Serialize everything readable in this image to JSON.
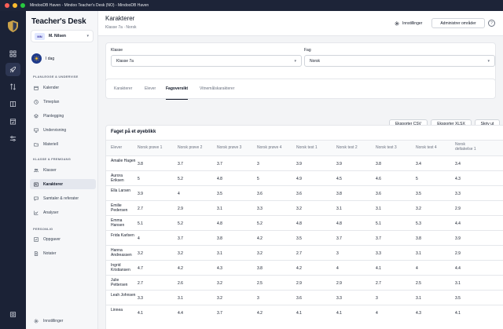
{
  "window": {
    "title": "MindooDB Haven - Mindoo Teacher's Desk (NO) - MindooDB Haven"
  },
  "colors": {
    "accent": "#1e3a8a",
    "rail_bg": "#1b2236",
    "active_nav": "#e4e7ee"
  },
  "rail": {
    "logo_icon": "shield-logo-icon",
    "items": [
      {
        "icon": "grid-icon"
      },
      {
        "icon": "rocket-icon"
      },
      {
        "icon": "arrows-icon"
      },
      {
        "icon": "book-icon"
      },
      {
        "icon": "calendar-check-icon"
      },
      {
        "icon": "sliders-icon"
      }
    ],
    "bottom_icon": "device-icon"
  },
  "sidebar": {
    "brand": "Teacher's Desk",
    "user": {
      "initials": "MN",
      "name": "M. Nilsen"
    },
    "today_label": "I dag",
    "sections": [
      {
        "title": "PLANLEGGE & UNDERVISE",
        "items": [
          {
            "label": "Kalender",
            "icon": "calendar-icon"
          },
          {
            "label": "Timeplan",
            "icon": "clock-icon"
          },
          {
            "label": "Planlegging",
            "icon": "layers-icon"
          },
          {
            "label": "Undervisning",
            "icon": "presentation-icon"
          },
          {
            "label": "Materiell",
            "icon": "folder-icon"
          }
        ]
      },
      {
        "title": "KLASSE & FREMGANG",
        "items": [
          {
            "label": "Klasser",
            "icon": "users-icon"
          },
          {
            "label": "Karakterer",
            "icon": "grade-icon"
          },
          {
            "label": "Samtaler & referater",
            "icon": "chat-icon"
          },
          {
            "label": "Analyser",
            "icon": "chart-icon"
          }
        ]
      },
      {
        "title": "PERSONLIG",
        "items": [
          {
            "label": "Oppgaver",
            "icon": "checkbox-icon"
          },
          {
            "label": "Notater",
            "icon": "note-icon"
          }
        ]
      }
    ],
    "settings_label": "Innstillinger"
  },
  "header": {
    "title": "Karakterer",
    "breadcrumb": "Klasse 7a · Norsk",
    "settings_label": "Innstillinger",
    "admin_label": "Administrer områder",
    "help_label": "?"
  },
  "filters": {
    "class_label": "Klasse",
    "class_value": "Klasse 7a",
    "subject_label": "Fag",
    "subject_value": "Norsk"
  },
  "tabs": [
    "Karakterer",
    "Elever",
    "Fagoversikt",
    "Vitnemålskarakterer"
  ],
  "active_tab_index": 2,
  "card": {
    "title": "Faget på et øyeblikk",
    "export_csv": "Eksporter CSV",
    "export_xlsx": "Eksporter XLSX",
    "print": "Skriv ut"
  },
  "table": {
    "headers": [
      "Elever",
      "Norsk prøve 1",
      "Norsk prøve 2",
      "Norsk prøve 3",
      "Norsk prøve 4",
      "Norsk test 1",
      "Norsk test 2",
      "Norsk test 3",
      "Norsk test 4",
      "Norsk deltakelse 1"
    ],
    "rows": [
      {
        "name": "Amalie Hagen",
        "values": [
          "3.8",
          "3.7",
          "3.7",
          "3",
          "3.9",
          "3.9",
          "3.8",
          "3.4",
          "3.4"
        ]
      },
      {
        "name": "Aurora Eriksen",
        "values": [
          "5",
          "5.2",
          "4.8",
          "5",
          "4.9",
          "4.5",
          "4.6",
          "5",
          "4.3"
        ]
      },
      {
        "name": "Ella Larsen",
        "values": [
          "3.9",
          "4",
          "3.5",
          "3.6",
          "3.6",
          "3.8",
          "3.6",
          "3.5",
          "3.3"
        ]
      },
      {
        "name": "Emilie Pedersen",
        "values": [
          "2.7",
          "2.9",
          "3.1",
          "3.3",
          "3.2",
          "3.1",
          "3.1",
          "3.2",
          "2.9"
        ]
      },
      {
        "name": "Emma Hansen",
        "values": [
          "5.1",
          "5.2",
          "4.8",
          "5.2",
          "4.8",
          "4.8",
          "5.1",
          "5.3",
          "4.4"
        ]
      },
      {
        "name": "Frida Karlsen",
        "values": [
          "4",
          "3.7",
          "3.8",
          "4.2",
          "3.5",
          "3.7",
          "3.7",
          "3.8",
          "3.9"
        ]
      },
      {
        "name": "Hanna Andreassen",
        "values": [
          "3.2",
          "3.2",
          "3.1",
          "3.2",
          "2.7",
          "3",
          "3.3",
          "3.1",
          "2.9"
        ]
      },
      {
        "name": "Ingrid Kristiansen",
        "values": [
          "4.7",
          "4.2",
          "4.3",
          "3.8",
          "4.2",
          "4",
          "4.1",
          "4",
          "4.4"
        ]
      },
      {
        "name": "Julie Pettersen",
        "values": [
          "2.7",
          "2.6",
          "3.2",
          "2.5",
          "2.9",
          "2.9",
          "2.7",
          "2.5",
          "3.1"
        ]
      },
      {
        "name": "Leah Johnsen",
        "values": [
          "3.3",
          "3.1",
          "3.2",
          "3",
          "3.6",
          "3.3",
          "3",
          "3.1",
          "3.5"
        ]
      },
      {
        "name": "Linnea",
        "values": [
          "4.1",
          "4.4",
          "3.7",
          "4.2",
          "4.1",
          "4.1",
          "4",
          "4.3",
          "4.1"
        ]
      }
    ]
  }
}
